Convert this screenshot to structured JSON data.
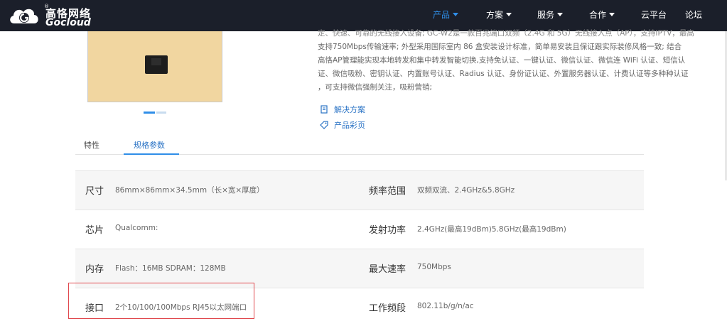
{
  "brand": {
    "name_cn": "高恪网络",
    "name_en": "Gocloud",
    "reg_mark": "®"
  },
  "nav": {
    "items": [
      {
        "label": "产品",
        "has_caret": true,
        "active": true
      },
      {
        "label": "方案",
        "has_caret": true,
        "active": false
      },
      {
        "label": "服务",
        "has_caret": true,
        "active": false
      },
      {
        "label": "合作",
        "has_caret": true,
        "active": false
      },
      {
        "label": "云平台",
        "has_caret": false,
        "active": false
      },
      {
        "label": "论坛",
        "has_caret": false,
        "active": false
      }
    ]
  },
  "product": {
    "description_lines": [
      "定、快速、可靠的无线接入设备; GC-W2是一款百兆端口双频（2.4G 和 5G）无线接入点（AP），支持IPTV，最高",
      "支持750Mbps传输速率; 外型采用国际室内 86 盒安装设计标准，简单易安装且保证跟实际装修风格一致; 结合",
      "高恪AP管理能实现本地转发和集中转发智能切换,支持免认证、一键认证、微信认证、微信连 WiFi 认证、短信认",
      "证、微信吸粉、密钥认证、内置账号认证、Radius 认证、身份证认证、外置服务器认证、计费认证等多种种认证",
      "，可支持微信强制关注，吸粉营销;"
    ],
    "links": [
      {
        "label": "解决方案",
        "icon": "document-icon"
      },
      {
        "label": "产品彩页",
        "icon": "tag-icon"
      }
    ]
  },
  "tabs": [
    {
      "label": "特性",
      "active": false
    },
    {
      "label": "规格参数",
      "active": true
    }
  ],
  "specs": {
    "rows": [
      {
        "left_label": "尺寸",
        "left_value": "86mm×86mm×34.5mm（长×宽×厚度）",
        "right_label": "频率范围",
        "right_value": "双频双流、2.4GHz&5.8GHz"
      },
      {
        "left_label": "芯片",
        "left_value": "Qualcomm:",
        "right_label": "发射功率",
        "right_value": "2.4GHz(最高19dBm)5.8GHz(最高19dBm)"
      },
      {
        "left_label": "内存",
        "left_value": "Flash：16MB SDRAM：128MB",
        "right_label": "最大速率",
        "right_value": "750Mbps"
      },
      {
        "left_label": "接口",
        "left_value": "2个10/100/100Mbps RJ45以太网端口",
        "right_label": "工作频段",
        "right_value": "802.11b/g/n/ac"
      }
    ]
  },
  "colors": {
    "header_bg": "#1b1f2a",
    "accent_blue": "#2f8ee8",
    "link_blue": "#2a73c5",
    "highlight_red": "#e0474c",
    "product_gold": "#f1d6a0"
  }
}
